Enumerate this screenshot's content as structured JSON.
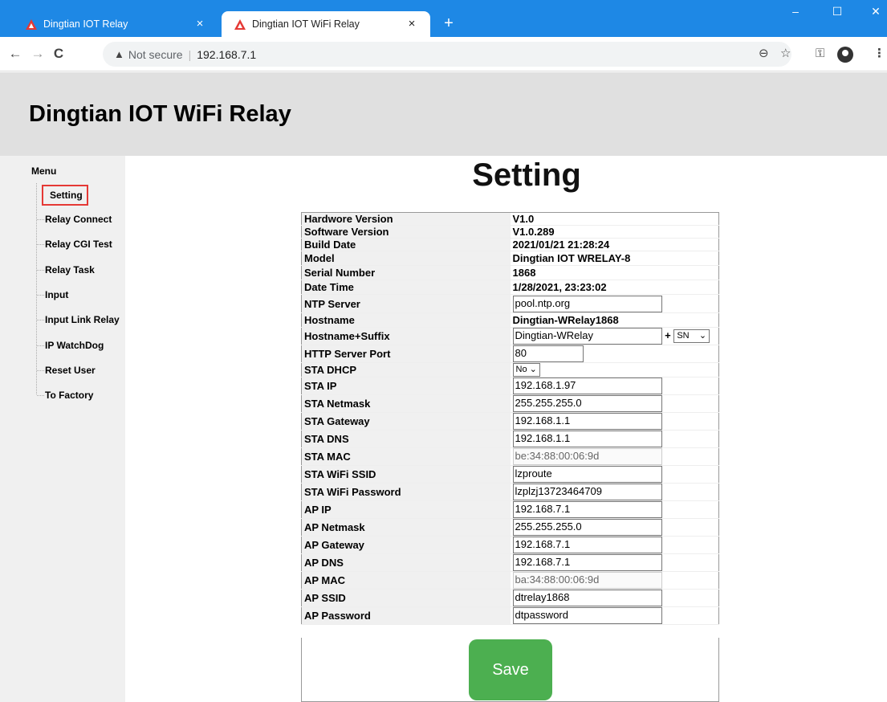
{
  "browser": {
    "tabs": [
      {
        "title": "Dingtian IOT Relay",
        "active": false
      },
      {
        "title": "Dingtian IOT WiFi Relay",
        "active": true
      }
    ],
    "close_glyph": "×",
    "new_tab_glyph": "+",
    "window_controls": {
      "minimize": "–",
      "maximize": "☐",
      "close": "✕"
    },
    "back_glyph": "←",
    "forward_glyph": "→",
    "reload_glyph": "C",
    "security_label": "Not secure",
    "separator": "|",
    "url": "192.168.7.1",
    "icons": [
      "zoom-icon",
      "star-icon",
      "key-icon",
      "profile-icon",
      "more-icon"
    ]
  },
  "page": {
    "header_title": "Dingtian IOT WiFi Relay",
    "main_title": "Setting"
  },
  "sidebar": {
    "title": "Menu",
    "items": [
      {
        "label": "Setting",
        "active": true
      },
      {
        "label": "Relay Connect"
      },
      {
        "label": "Relay CGI Test"
      },
      {
        "label": "Relay Task"
      },
      {
        "label": "Input"
      },
      {
        "label": "Input Link Relay"
      },
      {
        "label": "IP WatchDog"
      },
      {
        "label": "Reset User"
      },
      {
        "label": "To Factory"
      }
    ]
  },
  "settings": {
    "hardware_version": {
      "label": "Hardwore Version",
      "value": "V1.0"
    },
    "software_version": {
      "label": "Software Version",
      "value": "V1.0.289"
    },
    "build_date": {
      "label": "Build Date",
      "value": "2021/01/21 21:28:24"
    },
    "model": {
      "label": "Model",
      "value": "Dingtian IOT WRELAY-8"
    },
    "serial_number": {
      "label": "Serial Number",
      "value": "1868"
    },
    "date_time": {
      "label": "Date Time",
      "value": "1/28/2021, 23:23:02"
    },
    "ntp_server": {
      "label": "NTP Server",
      "value": "pool.ntp.org"
    },
    "hostname": {
      "label": "Hostname",
      "value": "Dingtian-WRelay1868"
    },
    "hostname_suffix": {
      "label": "Hostname+Suffix",
      "value": "Dingtian-WRelay",
      "plus": "+",
      "suffix": "SN"
    },
    "http_port": {
      "label": "HTTP Server Port",
      "value": "80"
    },
    "sta_dhcp": {
      "label": "STA DHCP",
      "value": "No"
    },
    "sta_ip": {
      "label": "STA IP",
      "value": "192.168.1.97"
    },
    "sta_netmask": {
      "label": "STA Netmask",
      "value": "255.255.255.0"
    },
    "sta_gateway": {
      "label": "STA Gateway",
      "value": "192.168.1.1"
    },
    "sta_dns": {
      "label": "STA DNS",
      "value": "192.168.1.1"
    },
    "sta_mac": {
      "label": "STA MAC",
      "value": "be:34:88:00:06:9d"
    },
    "sta_ssid": {
      "label": "STA WiFi SSID",
      "value": "lzproute"
    },
    "sta_password": {
      "label": "STA WiFi Password",
      "value": "lzplzj13723464709"
    },
    "ap_ip": {
      "label": "AP IP",
      "value": "192.168.7.1"
    },
    "ap_netmask": {
      "label": "AP Netmask",
      "value": "255.255.255.0"
    },
    "ap_gateway": {
      "label": "AP Gateway",
      "value": "192.168.7.1"
    },
    "ap_dns": {
      "label": "AP DNS",
      "value": "192.168.7.1"
    },
    "ap_mac": {
      "label": "AP MAC",
      "value": "ba:34:88:00:06:9d"
    },
    "ap_ssid": {
      "label": "AP SSID",
      "value": "dtrelay1868"
    },
    "ap_password": {
      "label": "AP Password",
      "value": "dtpassword"
    }
  },
  "save_label": "Save",
  "colors": {
    "tabbar": "#1e88e5",
    "header_bg": "#e0e0e0",
    "sidebar_bg": "#f0f0f0",
    "save_button": "#4caf50",
    "active_outline": "#e53935",
    "warning_logo": "#e53935"
  }
}
